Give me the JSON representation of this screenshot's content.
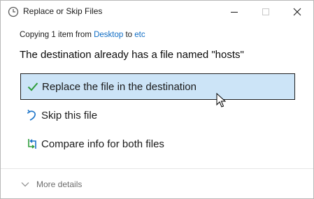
{
  "window": {
    "title": "Replace or Skip Files"
  },
  "copy_status": {
    "prefix": "Copying 1 item from ",
    "source": "Desktop",
    "middle": " to ",
    "destination": "etc"
  },
  "headline": "The destination already has a file named \"hosts\"",
  "options": [
    {
      "label": "Replace the file in the destination",
      "icon": "checkmark-icon",
      "selected": true
    },
    {
      "label": "Skip this file",
      "icon": "skip-arrow-icon",
      "selected": false
    },
    {
      "label": "Compare info for both files",
      "icon": "compare-icon",
      "selected": false
    }
  ],
  "details": {
    "label": "More details",
    "icon": "chevron-down-icon"
  },
  "colors": {
    "link": "#0e6cc4",
    "selected_bg": "#cce4f7",
    "check_green": "#2e9c3a",
    "icon_blue": "#1a73c8"
  }
}
